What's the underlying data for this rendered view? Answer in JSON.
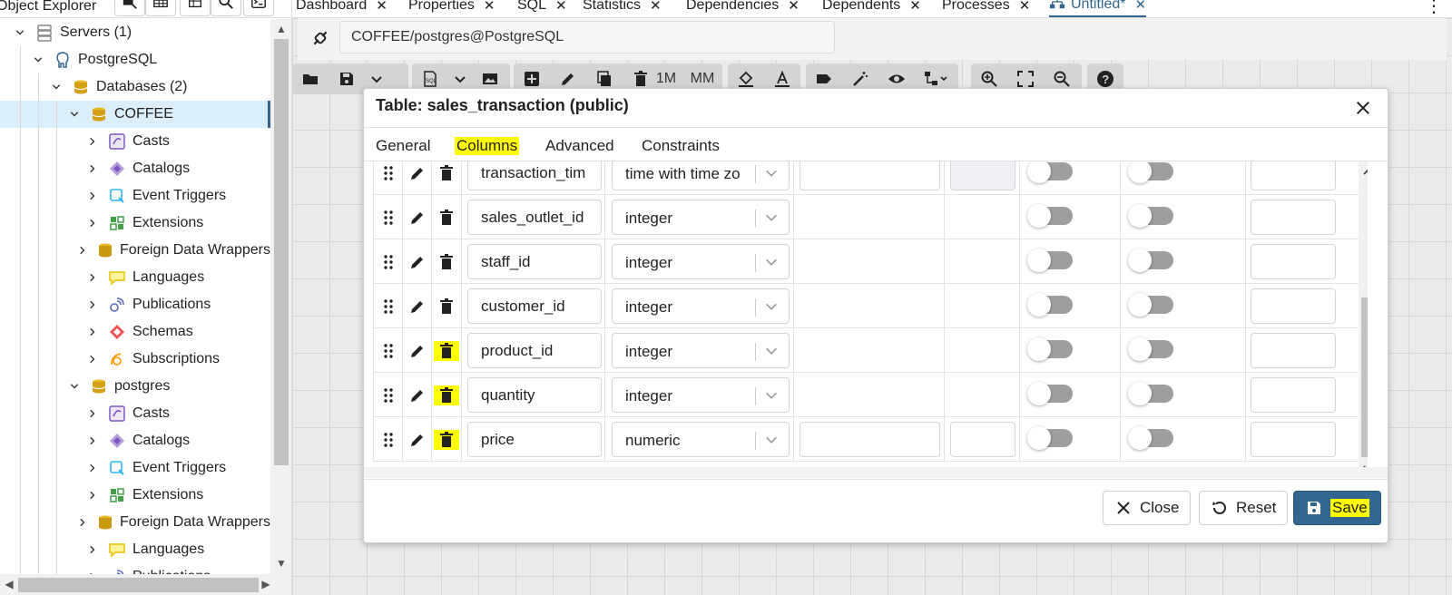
{
  "explorer": {
    "title": "Object Explorer",
    "tree": [
      {
        "label": "Servers (1)",
        "icon": "servers-icon",
        "level": 0,
        "expanded": true
      },
      {
        "label": "PostgreSQL",
        "icon": "postgres-elephant-icon",
        "level": 1,
        "expanded": true
      },
      {
        "label": "Databases (2)",
        "icon": "databases-icon",
        "level": 2,
        "expanded": true
      },
      {
        "label": "COFFEE",
        "icon": "database-icon",
        "level": 3,
        "expanded": true,
        "selected": true
      },
      {
        "label": "Casts",
        "icon": "casts-icon",
        "level": 4
      },
      {
        "label": "Catalogs",
        "icon": "catalogs-icon",
        "level": 4
      },
      {
        "label": "Event Triggers",
        "icon": "event-triggers-icon",
        "level": 4
      },
      {
        "label": "Extensions",
        "icon": "extensions-icon",
        "level": 4
      },
      {
        "label": "Foreign Data Wrappers",
        "icon": "foreign-data-wrappers-icon",
        "level": 4
      },
      {
        "label": "Languages",
        "icon": "languages-icon",
        "level": 4
      },
      {
        "label": "Publications",
        "icon": "publications-icon",
        "level": 4
      },
      {
        "label": "Schemas",
        "icon": "schemas-icon",
        "level": 4
      },
      {
        "label": "Subscriptions",
        "icon": "subscriptions-icon",
        "level": 4
      },
      {
        "label": "postgres",
        "icon": "database-icon",
        "level": 3,
        "expanded": true
      },
      {
        "label": "Casts",
        "icon": "casts-icon",
        "level": 4
      },
      {
        "label": "Catalogs",
        "icon": "catalogs-icon",
        "level": 4
      },
      {
        "label": "Event Triggers",
        "icon": "event-triggers-icon",
        "level": 4
      },
      {
        "label": "Extensions",
        "icon": "extensions-icon",
        "level": 4
      },
      {
        "label": "Foreign Data Wrappers",
        "icon": "foreign-data-wrappers-icon",
        "level": 4
      },
      {
        "label": "Languages",
        "icon": "languages-icon",
        "level": 4
      },
      {
        "label": "Publications",
        "icon": "publications-icon",
        "level": 4
      }
    ]
  },
  "tabs": [
    {
      "label": "Dashboard"
    },
    {
      "label": "Properties"
    },
    {
      "label": "SQL"
    },
    {
      "label": "Statistics"
    },
    {
      "label": "Dependencies"
    },
    {
      "label": "Dependents"
    },
    {
      "label": "Processes"
    },
    {
      "label": "Untitled*",
      "active": true
    }
  ],
  "connection": {
    "label": "COFFEE/postgres@PostgreSQL"
  },
  "toolbar": {
    "btn_1m": "1M",
    "btn_mm": "MM"
  },
  "dialog": {
    "title": "Table: sales_transaction (public)",
    "tabs": [
      "General",
      "Columns",
      "Advanced",
      "Constraints"
    ],
    "active_tab": "Columns",
    "columns": [
      {
        "name": "transaction_tim",
        "type": "time with time zo",
        "extra_fields": true,
        "highlight_delete": false
      },
      {
        "name": "sales_outlet_id",
        "type": "integer",
        "extra_fields": false,
        "highlight_delete": false
      },
      {
        "name": "staff_id",
        "type": "integer",
        "extra_fields": false,
        "highlight_delete": false
      },
      {
        "name": "customer_id",
        "type": "integer",
        "extra_fields": false,
        "highlight_delete": false
      },
      {
        "name": "product_id",
        "type": "integer",
        "extra_fields": false,
        "highlight_delete": true
      },
      {
        "name": "quantity",
        "type": "integer",
        "extra_fields": false,
        "highlight_delete": true
      },
      {
        "name": "price",
        "type": "numeric",
        "extra_fields": true,
        "highlight_delete": true
      }
    ],
    "buttons": {
      "close": "Close",
      "reset": "Reset",
      "save": "Save"
    }
  },
  "colors": {
    "accent": "#326690",
    "highlight": "#ffff00",
    "selected_row": "#dbeefb"
  }
}
